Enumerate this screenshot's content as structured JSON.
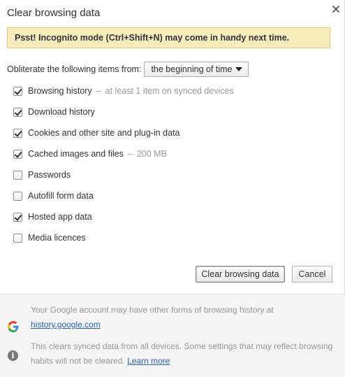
{
  "dialog": {
    "title": "Clear browsing data",
    "close_glyph": "×"
  },
  "banner": {
    "text": "Psst! Incognito mode (Ctrl+Shift+N) may come in handy next time."
  },
  "obliterate": {
    "label": "Obliterate the following items from:",
    "selected": "the beginning of time"
  },
  "options": [
    {
      "label": "Browsing history",
      "detail": "at least 1 item on synced devices",
      "checked": true
    },
    {
      "label": "Download history",
      "detail": "",
      "checked": true
    },
    {
      "label": "Cookies and other site and plug-in data",
      "detail": "",
      "checked": true
    },
    {
      "label": "Cached images and files",
      "detail": "200 MB",
      "checked": true
    },
    {
      "label": "Passwords",
      "detail": "",
      "checked": false
    },
    {
      "label": "Autofill form data",
      "detail": "",
      "checked": false
    },
    {
      "label": "Hosted app data",
      "detail": "",
      "checked": true
    },
    {
      "label": "Media licences",
      "detail": "",
      "checked": false
    }
  ],
  "options_separator": "–",
  "buttons": {
    "clear_label": "Clear browsing data",
    "cancel_label": "Cancel"
  },
  "footer": {
    "google_text": "Your Google account may have other forms of browsing history at",
    "google_link": "history.google.com",
    "info_text": "This clears synced data from all devices. Some settings that may reflect browsing habits will not be cleared.",
    "info_link": "Learn more",
    "info_glyph": "i"
  },
  "colors": {
    "banner_bg": "#f9edbe",
    "banner_border": "#f0c36d",
    "link": "#2962c9",
    "google_blue": "#4285F4",
    "google_red": "#EA4335",
    "google_yellow": "#FBBC05",
    "google_green": "#34A853"
  },
  "icons": {
    "close": "close-icon",
    "dropdown": "triangle-down-icon",
    "google": "google-g-icon",
    "info": "info-icon",
    "checkmark": "checkmark-icon"
  }
}
